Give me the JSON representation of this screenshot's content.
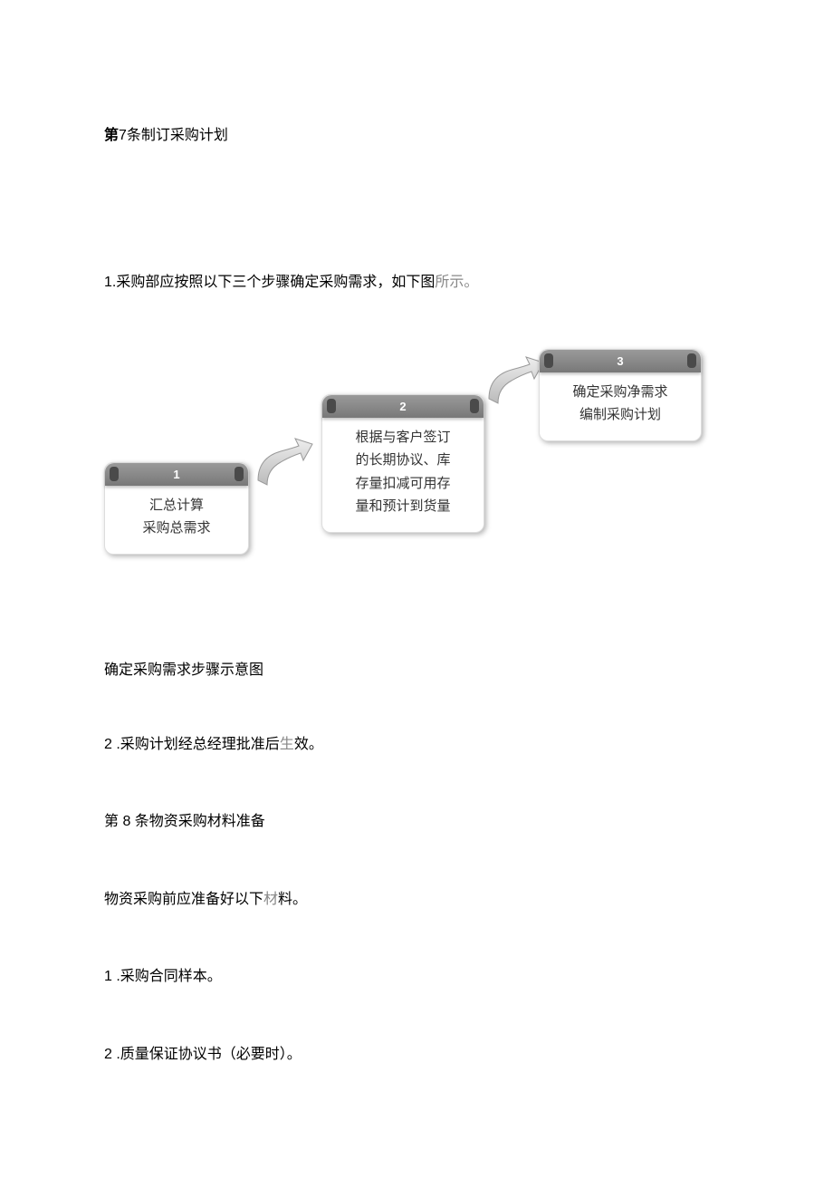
{
  "article7": {
    "prefix": "第",
    "number": "7",
    "suffix": "条制订采购计划"
  },
  "intro_line": {
    "black": "1.采购部应按照以下三个步骤确定采购需求，如下图",
    "gray": "所示。"
  },
  "diagram": {
    "step1": {
      "num": "1",
      "line1": "汇总计算",
      "line2": "采购总需求"
    },
    "step2": {
      "num": "2",
      "line1": "根据与客户签订",
      "line2": "的长期协议、库",
      "line3": "存量扣减可用存",
      "line4": "量和预计到货量"
    },
    "step3": {
      "num": "3",
      "line1": "确定采购净需求",
      "line2": "编制采购计划"
    }
  },
  "caption": "确定采购需求步骤示意图",
  "item2": {
    "black1": "2  .采购计划经总经理批准后",
    "gray": "生",
    "black2": "效。"
  },
  "article8": "第 8 条物资采购材料准备",
  "prep_line": {
    "black1": "物资采购前应准备好以下",
    "gray": "材",
    "black2": "料。"
  },
  "list1": "1  .采购合同样本。",
  "list2": "2  .质量保证协议书（必要时）。"
}
